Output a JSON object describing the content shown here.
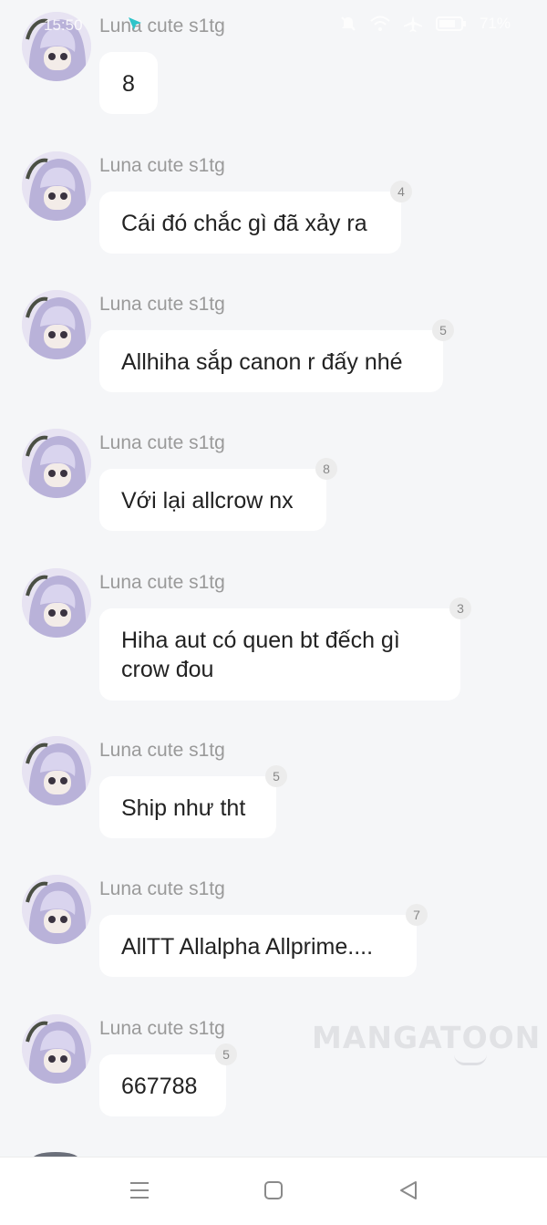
{
  "status_bar": {
    "time": "15:50",
    "battery": "71%",
    "icons": [
      "cursor-app-icon",
      "mute-bell-icon",
      "wifi-icon",
      "airplane-icon",
      "battery-icon"
    ]
  },
  "messages": [
    {
      "sender": "Luna cute s1tg",
      "text": "8",
      "badge": ""
    },
    {
      "sender": "Luna cute s1tg",
      "text": "Cái đó chắc gì đã xảy ra",
      "badge": "4"
    },
    {
      "sender": "Luna cute s1tg",
      "text": "Allhiha sắp canon r đấy nhé",
      "badge": "5"
    },
    {
      "sender": "Luna cute s1tg",
      "text": "Với lại allcrow nx",
      "badge": "8"
    },
    {
      "sender": "Luna cute s1tg",
      "text": "Hiha aut có quen bt đếch gì crow đou",
      "badge": "3"
    },
    {
      "sender": "Luna cute s1tg",
      "text": "Ship như tht",
      "badge": "5"
    },
    {
      "sender": "Luna cute s1tg",
      "text": "AllTT Allalpha Allprime....",
      "badge": "7"
    },
    {
      "sender": "Luna cute s1tg",
      "text": "667788",
      "badge": "5"
    }
  ],
  "watermark": "MANGATOON",
  "nav_bar": {
    "icons": [
      "menu-icon",
      "home-square-icon",
      "back-triangle-icon"
    ]
  },
  "colors": {
    "background": "#f5f6f8",
    "bubble": "#ffffff",
    "sender": "#9a9a9a",
    "badge_bg": "#ececec"
  }
}
